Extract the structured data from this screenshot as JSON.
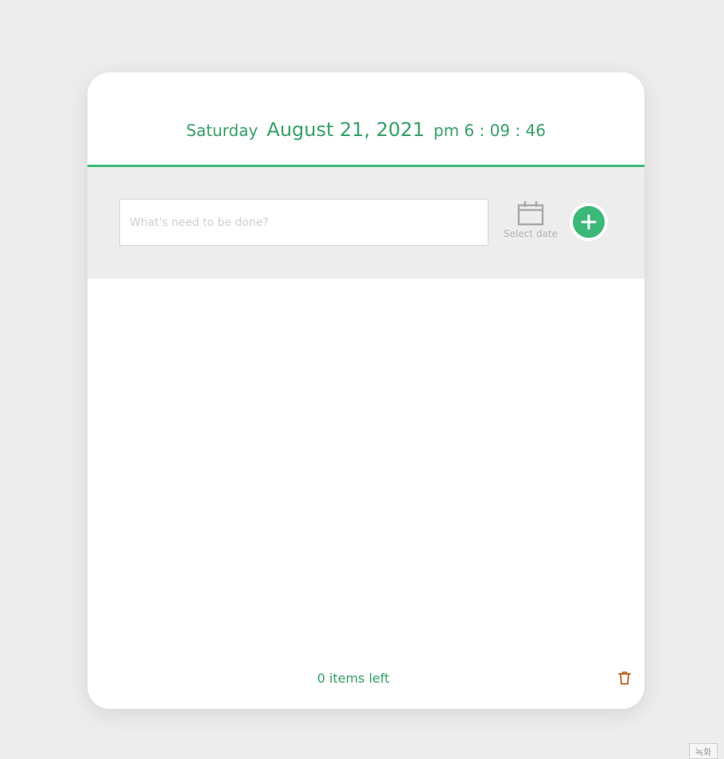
{
  "header": {
    "weekday": "Saturday",
    "date": "August 21, 2021",
    "time": "pm 6 : 09 : 46"
  },
  "input_bar": {
    "placeholder": "What's need to be done?",
    "date_picker_label": "Select date",
    "date_picker_icon": "calendar-icon",
    "add_icon": "plus-icon"
  },
  "footer": {
    "items_left": "0 items left",
    "trash_icon": "trash-icon"
  },
  "corner_badge": {
    "label": "녹화"
  },
  "colors": {
    "accent": "#3cb878",
    "text_accent": "#35a066",
    "trash": "#c05a10",
    "background": "#ecedec"
  }
}
